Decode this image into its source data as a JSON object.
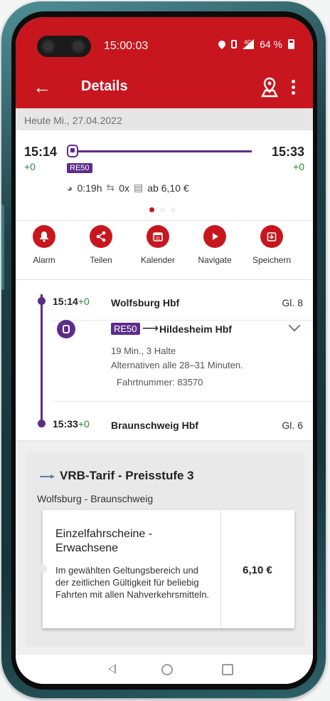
{
  "status_bar": {
    "time": "15:00:03",
    "network": "4G",
    "battery": "64 %"
  },
  "toolbar": {
    "title": "Details"
  },
  "date_bar": {
    "text": "Heute Mi., 27.04.2022"
  },
  "summary": {
    "departure_time": "15:14",
    "departure_delay": "+0",
    "arrival_time": "15:33",
    "arrival_delay": "+0",
    "line": "RE50",
    "duration": "0:19h",
    "transfers": "0x",
    "price": "ab 6,10 €",
    "page_indicator": {
      "count": 3,
      "active": 1
    }
  },
  "actions": [
    {
      "label": "Alarm",
      "icon": "bell-icon"
    },
    {
      "label": "Teilen",
      "icon": "share-icon"
    },
    {
      "label": "Kalender",
      "icon": "calendar-icon"
    },
    {
      "label": "Navigate",
      "icon": "play-icon"
    },
    {
      "label": "Speichern",
      "icon": "save-icon"
    }
  ],
  "journey": {
    "origin": {
      "time": "15:14",
      "delay": "+0",
      "name": "Wolfsburg Hbf",
      "track": "Gl. 8"
    },
    "leg": {
      "line": "RE50",
      "arrow": "⟶",
      "destination": "Hildesheim Hbf",
      "duration_stops": "19 Min., 3 Halte",
      "alternatives": "Alternativen alle 28–31 Minuten.",
      "trip_number": "Fahrtnummer: 83570"
    },
    "destination": {
      "time": "15:33",
      "delay": "+0",
      "name": "Braunschweig Hbf",
      "track": "Gl. 6"
    }
  },
  "tariff": {
    "title": "VRB-Tarif - Preisstufe 3",
    "route": "Wolfsburg - Braunschweig",
    "ticket": {
      "title": "Einzelfahrscheine - Erwachsene",
      "description": "Im gewählten Geltungsbereich und der zeitlichen Gültigkeit für beliebig Fahrten mit allen Nahverkehrsmitteln.",
      "price": "6,10 €"
    }
  },
  "colors": {
    "brand_red": "#c8161e",
    "line_purple": "#5d2c8b",
    "delay_green": "#2a8a3a"
  }
}
